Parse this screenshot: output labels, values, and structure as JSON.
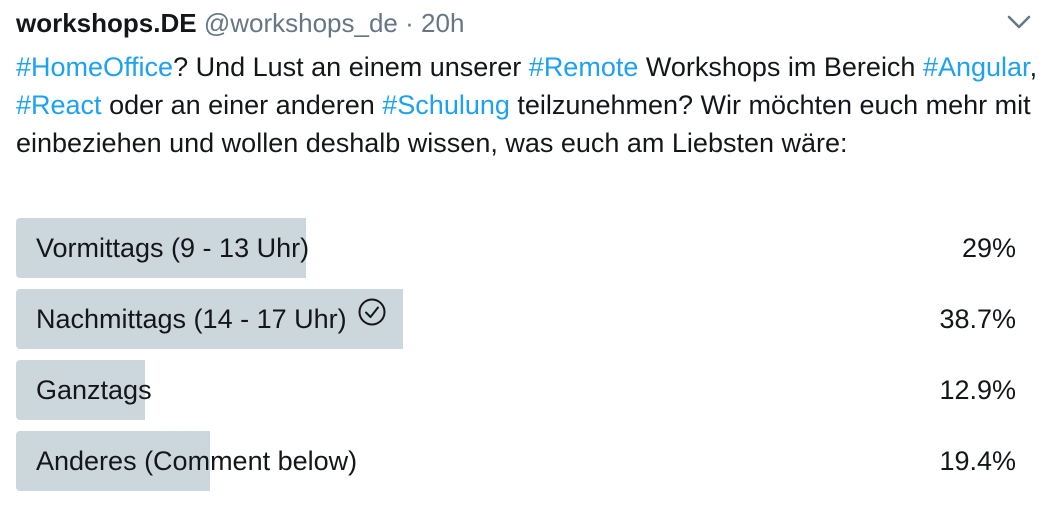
{
  "tweet": {
    "author_name": "workshops.DE",
    "handle": "@workshops_de",
    "separator": "·",
    "time": "20h",
    "text_parts": [
      {
        "text": "#HomeOffice",
        "hashtag": true
      },
      {
        "text": "? Und Lust an einem unserer ",
        "hashtag": false
      },
      {
        "text": "#Remote",
        "hashtag": true
      },
      {
        "text": " Workshops im Bereich ",
        "hashtag": false
      },
      {
        "text": "#Angular",
        "hashtag": true
      },
      {
        "text": ", ",
        "hashtag": false
      },
      {
        "text": "#React",
        "hashtag": true
      },
      {
        "text": " oder an einer anderen ",
        "hashtag": false
      },
      {
        "text": "#Schulung",
        "hashtag": true
      },
      {
        "text": " teilzunehmen? Wir möchten euch mehr mit einbeziehen und wollen deshalb wissen, was euch am Liebsten wäre:",
        "hashtag": false
      }
    ]
  },
  "icons": {
    "menu": "chevron-down-icon",
    "winner": "check-circle-icon"
  },
  "colors": {
    "bar": "#ccd6dd",
    "hashtag": "#1da1f2",
    "secondary_text": "#657786"
  },
  "chart_data": {
    "type": "bar",
    "orientation": "horizontal",
    "categories": [
      "Vormittags (9 - 13 Uhr)",
      "Nachmittags (14 - 17 Uhr)",
      "Ganztags",
      "Anderes (Comment below)"
    ],
    "values": [
      29,
      38.7,
      12.9,
      19.4
    ],
    "value_labels": [
      "29%",
      "38.7%",
      "12.9%",
      "19.4%"
    ],
    "unit": "%",
    "winner_index": 1,
    "xlim": [
      0,
      100
    ],
    "grid": false
  }
}
